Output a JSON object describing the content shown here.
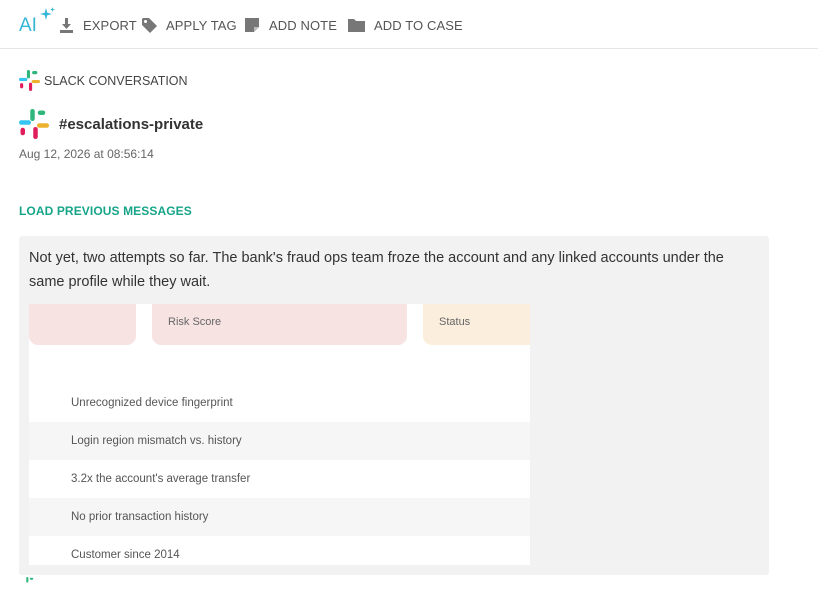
{
  "toolbar": {
    "logo_text": "AI",
    "export_label": "EXPORT",
    "apply_tag_label": "APPLY TAG",
    "add_note_label": "ADD NOTE",
    "add_to_case_label": "ADD TO CASE",
    "icons": [
      "ai-logo",
      "download-icon",
      "tag-icon",
      "note-icon",
      "folder-icon"
    ]
  },
  "conversation": {
    "source_label": "SLACK CONVERSATION",
    "channel": "#escalations-private",
    "timestamp": "Aug 12, 2026 at 08:56:14",
    "load_previous_label": "LOAD PREVIOUS MESSAGES"
  },
  "message": {
    "text": "Not yet, two attempts so far. The bank's fraud ops team froze the account and any linked accounts under the same profile while they wait.",
    "attachment": {
      "headers": [
        "",
        "Risk Score",
        "Status"
      ],
      "rows": [
        "Unrecognized device fingerprint",
        "Login region mismatch vs. history",
        "3.2x the account's average transfer",
        "No prior transaction history",
        "Customer since 2014"
      ]
    }
  },
  "colors": {
    "accent": "#17a589",
    "ai_logo": "#35b6d6",
    "header_pink": "#f8e3e3",
    "header_peach": "#fbeedd",
    "bubble": "#f2f2f2"
  }
}
